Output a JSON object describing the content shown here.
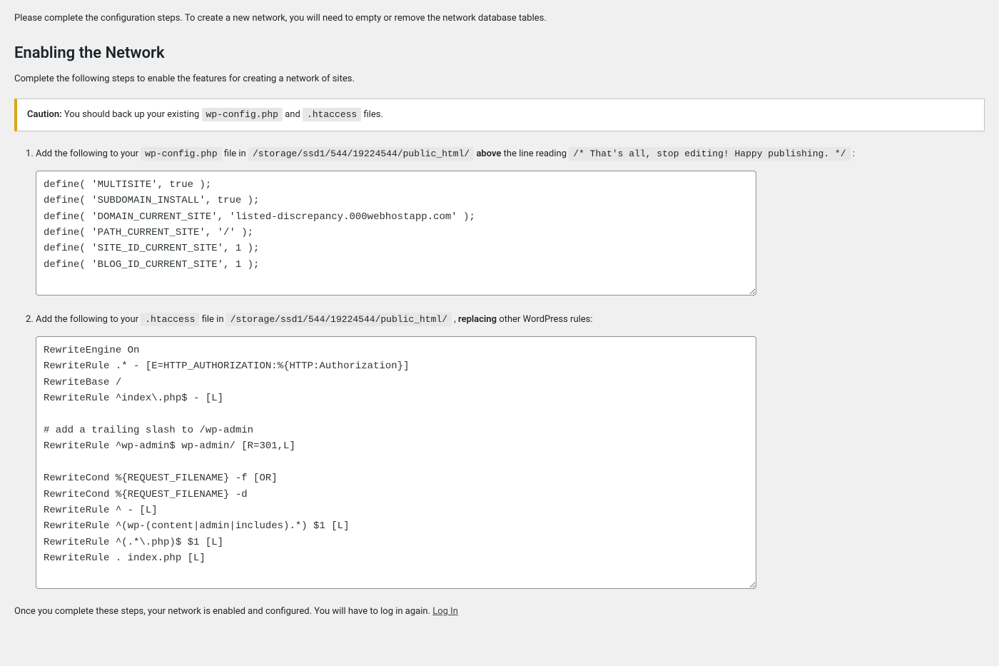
{
  "intro": "Please complete the configuration steps. To create a new network, you will need to empty or remove the network database tables.",
  "heading": "Enabling the Network",
  "sub": "Complete the following steps to enable the features for creating a network of sites.",
  "caution": {
    "label": "Caution:",
    "pre": "You should back up your existing ",
    "file1": "wp-config.php",
    "mid": " and ",
    "file2": ".htaccess",
    "post": " files."
  },
  "step1": {
    "pre": "Add the following to your ",
    "file": "wp-config.php",
    "mid1": " file in ",
    "path": "/storage/ssd1/544/19224544/public_html/",
    "mid2": " ",
    "above": "above",
    "mid3": " the line reading ",
    "comment": "/* That's all, stop editing! Happy publishing. */",
    "post": ":",
    "code": "define( 'MULTISITE', true );\ndefine( 'SUBDOMAIN_INSTALL', true );\ndefine( 'DOMAIN_CURRENT_SITE', 'listed-discrepancy.000webhostapp.com' );\ndefine( 'PATH_CURRENT_SITE', '/' );\ndefine( 'SITE_ID_CURRENT_SITE', 1 );\ndefine( 'BLOG_ID_CURRENT_SITE', 1 );\n"
  },
  "step2": {
    "pre": "Add the following to your ",
    "file": ".htaccess",
    "mid1": " file in ",
    "path": "/storage/ssd1/544/19224544/public_html/",
    "mid2": ", ",
    "replacing": "replacing",
    "post": " other WordPress rules:",
    "code": "RewriteEngine On\nRewriteRule .* - [E=HTTP_AUTHORIZATION:%{HTTP:Authorization}]\nRewriteBase /\nRewriteRule ^index\\.php$ - [L]\n\n# add a trailing slash to /wp-admin\nRewriteRule ^wp-admin$ wp-admin/ [R=301,L]\n\nRewriteCond %{REQUEST_FILENAME} -f [OR]\nRewriteCond %{REQUEST_FILENAME} -d\nRewriteRule ^ - [L]\nRewriteRule ^(wp-(content|admin|includes).*) $1 [L]\nRewriteRule ^(.*\\.php)$ $1 [L]\nRewriteRule . index.php [L]\n"
  },
  "final": {
    "text": "Once you complete these steps, your network is enabled and configured. You will have to log in again. ",
    "link": "Log In"
  }
}
